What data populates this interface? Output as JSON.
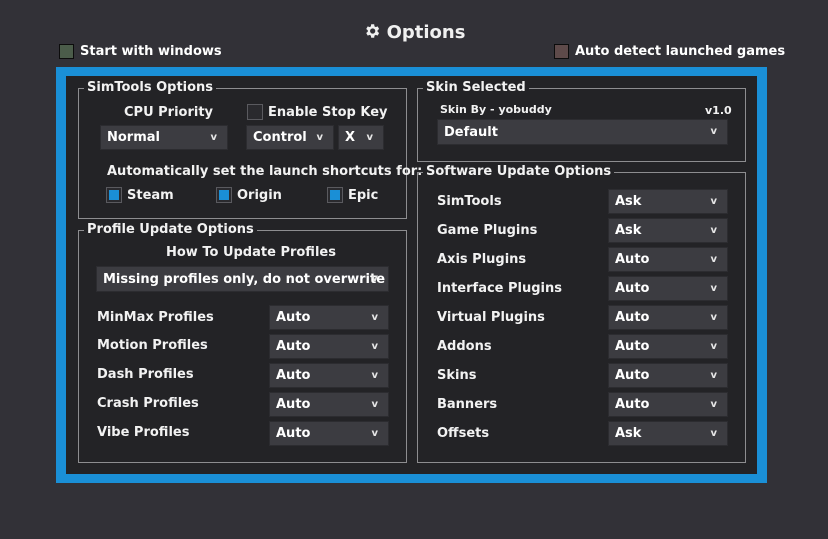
{
  "title": "Options",
  "start_with_windows": {
    "label": "Start with windows",
    "checked": false,
    "color": "#4b5c4a"
  },
  "auto_detect": {
    "label": "Auto detect launched games",
    "checked": false,
    "color": "#5e4a4a"
  },
  "accent_color": "#1a8fd6",
  "simtools_options": {
    "legend": "SimTools Options",
    "cpu_priority_label": "CPU Priority",
    "cpu_priority_value": "Normal",
    "enable_stop_key_label": "Enable Stop Key",
    "enable_stop_key_checked": false,
    "stop_key_modifier": "Control",
    "stop_key_key": "X",
    "shortcuts_label": "Automatically set the launch shortcuts for:",
    "steam": {
      "label": "Steam",
      "checked": true
    },
    "origin": {
      "label": "Origin",
      "checked": true
    },
    "epic": {
      "label": "Epic",
      "checked": true
    }
  },
  "profile_update": {
    "legend": "Profile Update Options",
    "how_label": "How To Update Profiles",
    "how_value": "Missing profiles only, do not overwrite",
    "rows": [
      {
        "label": "MinMax Profiles",
        "value": "Auto"
      },
      {
        "label": "Motion Profiles",
        "value": "Auto"
      },
      {
        "label": "Dash Profiles",
        "value": "Auto"
      },
      {
        "label": "Crash Profiles",
        "value": "Auto"
      },
      {
        "label": "Vibe Profiles",
        "value": "Auto"
      }
    ]
  },
  "skin_selected": {
    "legend": "Skin Selected",
    "author": "Skin By - yobuddy",
    "version": "v1.0",
    "value": "Default"
  },
  "software_update": {
    "legend": "Software Update Options",
    "rows": [
      {
        "label": "SimTools",
        "value": "Ask"
      },
      {
        "label": "Game Plugins",
        "value": "Ask"
      },
      {
        "label": "Axis Plugins",
        "value": "Auto"
      },
      {
        "label": "Interface Plugins",
        "value": "Auto"
      },
      {
        "label": "Virtual Plugins",
        "value": "Auto"
      },
      {
        "label": "Addons",
        "value": "Auto"
      },
      {
        "label": "Skins",
        "value": "Auto"
      },
      {
        "label": "Banners",
        "value": "Auto"
      },
      {
        "label": "Offsets",
        "value": "Ask"
      }
    ]
  },
  "chevron_glyph": "v"
}
